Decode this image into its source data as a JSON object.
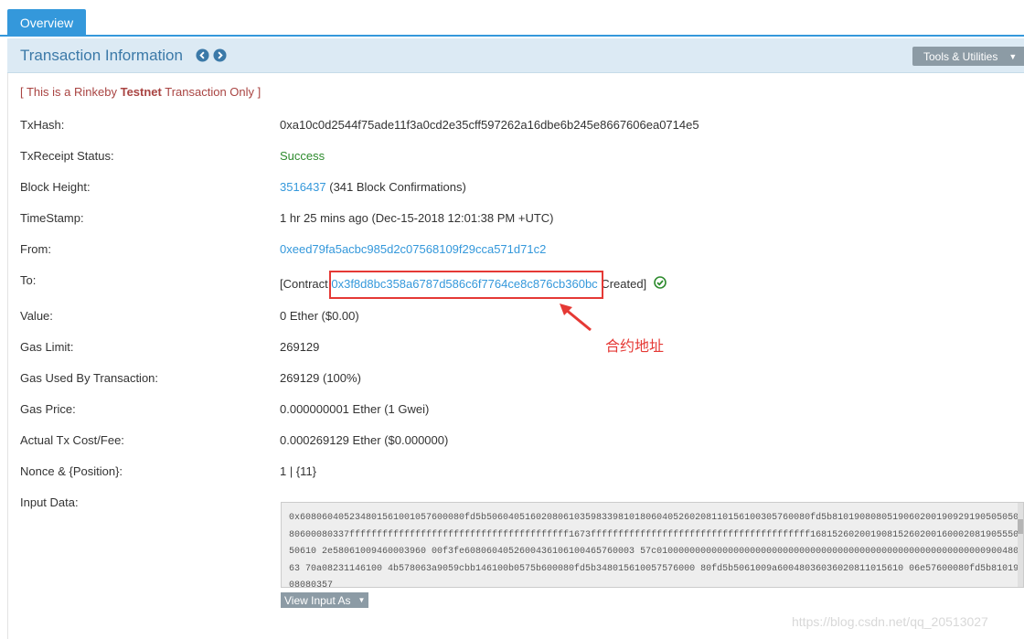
{
  "tabs": [
    {
      "label": "Overview"
    }
  ],
  "panel": {
    "title": "Transaction Information",
    "tools_label": "Tools & Utilities"
  },
  "notice": {
    "prefix": "[ This is a Rinkeby ",
    "bold": "Testnet",
    "suffix": " Transaction Only ]"
  },
  "fields": {
    "txhash": {
      "label": "TxHash:",
      "value": "0xa10c0d2544f75ade11f3a0cd2e35cff597262a16dbe6b245e8667606ea0714e5"
    },
    "status": {
      "label": "TxReceipt Status:",
      "value": "Success"
    },
    "block": {
      "label": "Block Height:",
      "value": "3516437",
      "extra": " (341 Block Confirmations)"
    },
    "timestamp": {
      "label": "TimeStamp:",
      "value": "1 hr 25 mins ago (Dec-15-2018 12:01:38 PM +UTC)"
    },
    "from": {
      "label": "From:",
      "value": "0xeed79fa5acbc985d2c07568109f29cca571d71c2"
    },
    "to": {
      "label": "To:",
      "prefix": "[Contract ",
      "value": "0x3f8d8bc358a6787d586c6f7764ce8c876cb360bc",
      "suffix": " Created]"
    },
    "value": {
      "label": "Value:",
      "value": "0 Ether ($0.00)"
    },
    "gas_limit": {
      "label": "Gas Limit:",
      "value": "269129"
    },
    "gas_used": {
      "label": "Gas Used By Transaction:",
      "value": "269129 (100%)"
    },
    "gas_price": {
      "label": "Gas Price:",
      "value": "0.000000001 Ether (1 Gwei)"
    },
    "fee": {
      "label": "Actual Tx Cost/Fee:",
      "value": "0.000269129 Ether ($0.000000)"
    },
    "nonce": {
      "label": "Nonce & {Position}:",
      "value": "1 | {11}"
    },
    "input": {
      "label": "Input Data:",
      "value": "0x608060405234801561001057600080fd5b50604051602080610359833981018060405260208110156100305760080fd5b810190808051906020019092919050505080600080337ffffffffffffffffffffffffffffffffffffffff1673ffffffffffffffffffffffffffffffffffffffff1681526020019081526020016000208190555050610 2e58061009460003960 00f3fe6080604052600436106100465760003 57c01000000000000000000000000000000000000000000000000000000000090048063 70a08231146100 4b578063a9059cbb146100b0575b600080fd5b348015610057576000 80fd5b5061009a60048036036020811015610 06e57600080fd5b8101908080357",
      "view_label": "View Input As"
    }
  },
  "annotation": "合约地址",
  "watermark": "https://blog.csdn.net/qq_20513027",
  "colors": {
    "accent": "#3498db",
    "success": "#2e8b2e",
    "warning": "#a94442",
    "highlight": "#e53935"
  }
}
